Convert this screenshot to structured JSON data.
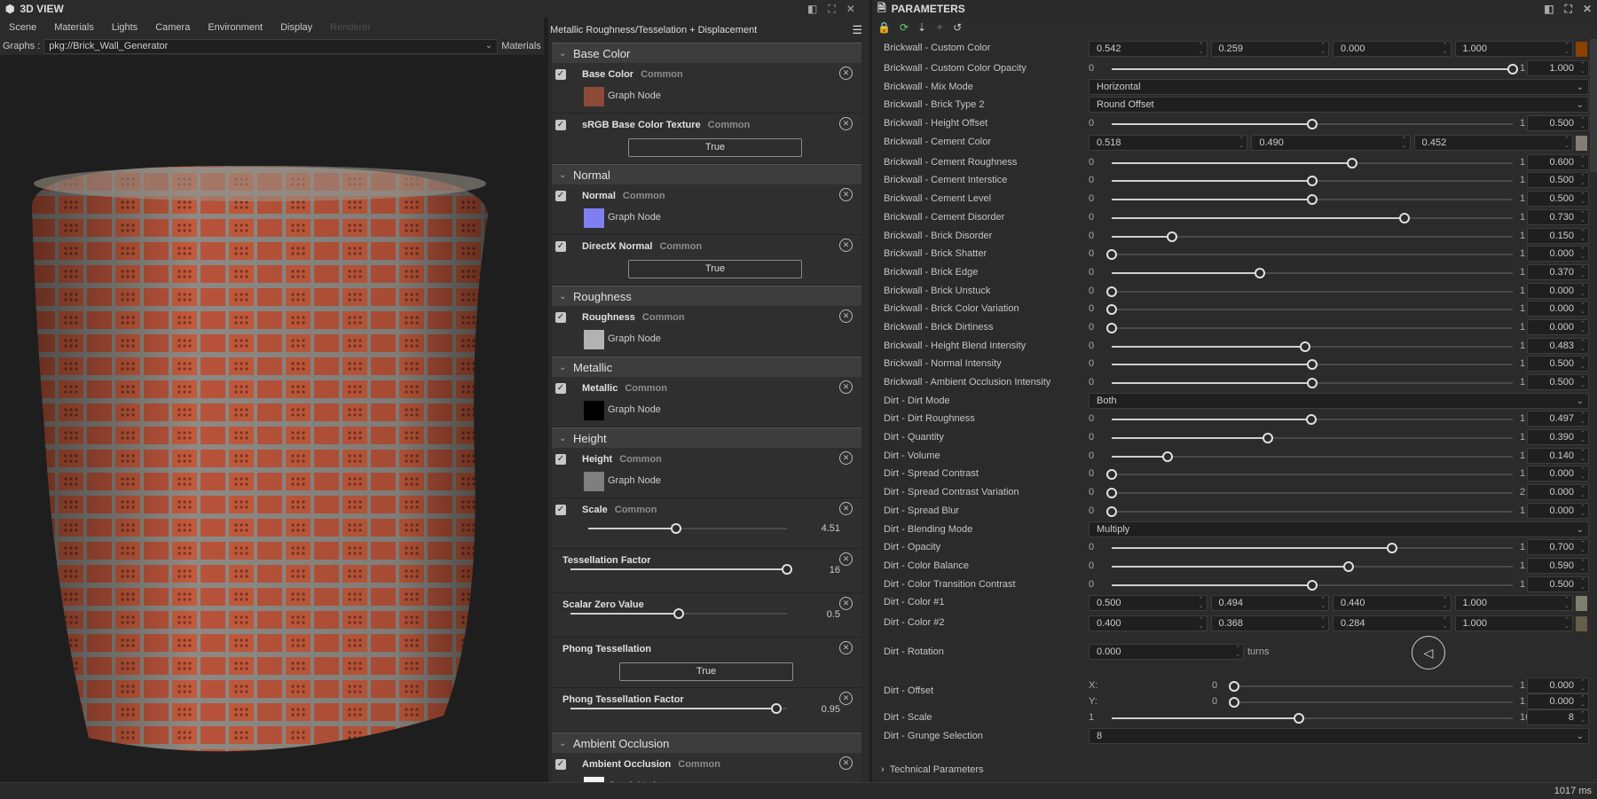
{
  "view3d": {
    "title": "3D VIEW",
    "menu": [
      "Scene",
      "Materials",
      "Lights",
      "Camera",
      "Environment",
      "Display",
      "Renderer"
    ],
    "graphs_label": "Graphs :",
    "graph_value": "pkg://Brick_Wall_Generator",
    "materials_label": "Materials"
  },
  "middle": {
    "title": "Metallic Roughness/Tesselation + Displacement",
    "sections": [
      {
        "title": "Base Color",
        "items": [
          {
            "kind": "node",
            "check": true,
            "name": "Base Color",
            "tag": "Common",
            "swatch": "#8e4a38",
            "node": "Graph Node"
          },
          {
            "kind": "bool",
            "check": true,
            "name": "sRGB Base Color Texture",
            "tag": "Common",
            "value": "True"
          }
        ]
      },
      {
        "title": "Normal",
        "items": [
          {
            "kind": "node",
            "check": true,
            "name": "Normal",
            "tag": "Common",
            "swatch": "#7f7ff2",
            "node": "Graph Node"
          },
          {
            "kind": "bool",
            "check": true,
            "name": "DirectX Normal",
            "tag": "Common",
            "value": "True"
          }
        ]
      },
      {
        "title": "Roughness",
        "items": [
          {
            "kind": "node",
            "check": true,
            "name": "Roughness",
            "tag": "Common",
            "swatch": "#b2b2b2",
            "node": "Graph Node"
          }
        ]
      },
      {
        "title": "Metallic",
        "items": [
          {
            "kind": "node",
            "check": true,
            "name": "Metallic",
            "tag": "Common",
            "swatch": "#000000",
            "node": "Graph Node"
          }
        ]
      },
      {
        "title": "Height",
        "items": [
          {
            "kind": "node",
            "check": true,
            "name": "Height",
            "tag": "Common",
            "swatch": "#7f7f7f",
            "node": "Graph Node"
          },
          {
            "kind": "slider",
            "check": true,
            "name": "Scale",
            "tag": "Common",
            "value": "4.51",
            "fraction": 0.44
          },
          {
            "kind": "slider",
            "check": false,
            "name": "Tessellation Factor",
            "value": "16",
            "fraction": 1.0
          },
          {
            "kind": "slider",
            "check": false,
            "name": "Scalar Zero Value",
            "value": "0.5",
            "fraction": 0.5
          },
          {
            "kind": "bool",
            "check": false,
            "name": "Phong Tessellation",
            "value": "True"
          },
          {
            "kind": "slider",
            "check": false,
            "name": "Phong Tessellation Factor",
            "value": "0.95",
            "fraction": 0.95
          }
        ]
      },
      {
        "title": "Ambient Occlusion",
        "items": [
          {
            "kind": "node",
            "check": true,
            "name": "Ambient Occlusion",
            "tag": "Common",
            "swatch": "#f2f2f2",
            "node": "Graph Node"
          }
        ]
      }
    ]
  },
  "params": {
    "title": "PARAMETERS",
    "rows": [
      {
        "type": "color",
        "label": "Brickwall - Custom Color",
        "values": [
          "0.542",
          "0.259",
          "0.000",
          "1.000"
        ],
        "swatch": "#8a4200"
      },
      {
        "type": "slider",
        "label": "Brickwall - Custom Color Opacity",
        "min": "0",
        "max": "1",
        "value": "1.000",
        "fraction": 1.0
      },
      {
        "type": "select",
        "label": "Brickwall - Mix Mode",
        "value": "Horizontal"
      },
      {
        "type": "select",
        "label": "Brickwall - Brick Type 2",
        "value": "Round Offset"
      },
      {
        "type": "slider",
        "label": "Brickwall - Height Offset",
        "min": "0",
        "max": "1",
        "value": "0.500",
        "fraction": 0.5
      },
      {
        "type": "color",
        "label": "Brickwall - Cement Color",
        "values": [
          "0.518",
          "0.490",
          "0.452"
        ],
        "swatch": "#847d73"
      },
      {
        "type": "slider",
        "label": "Brickwall - Cement Roughness",
        "min": "0",
        "max": "1",
        "value": "0.600",
        "fraction": 0.6
      },
      {
        "type": "slider",
        "label": "Brickwall - Cement Interstice",
        "min": "0",
        "max": "1",
        "value": "0.500",
        "fraction": 0.5
      },
      {
        "type": "slider",
        "label": "Brickwall - Cement Level",
        "min": "0",
        "max": "1",
        "value": "0.500",
        "fraction": 0.5
      },
      {
        "type": "slider",
        "label": "Brickwall - Cement Disorder",
        "min": "0",
        "max": "1",
        "value": "0.730",
        "fraction": 0.73
      },
      {
        "type": "slider",
        "label": "Brickwall - Brick Disorder",
        "min": "0",
        "max": "1",
        "value": "0.150",
        "fraction": 0.15
      },
      {
        "type": "slider",
        "label": "Brickwall - Brick Shatter",
        "min": "0",
        "max": "1",
        "value": "0.000",
        "fraction": 0
      },
      {
        "type": "slider",
        "label": "Brickwall - Brick Edge",
        "min": "0",
        "max": "1",
        "value": "0.370",
        "fraction": 0.37
      },
      {
        "type": "slider",
        "label": "Brickwall - Brick Unstuck",
        "min": "0",
        "max": "1",
        "value": "0.000",
        "fraction": 0
      },
      {
        "type": "slider",
        "label": "Brickwall - Brick Color Variation",
        "min": "0",
        "max": "1",
        "value": "0.000",
        "fraction": 0
      },
      {
        "type": "slider",
        "label": "Brickwall - Brick Dirtiness",
        "min": "0",
        "max": "1",
        "value": "0.000",
        "fraction": 0
      },
      {
        "type": "slider",
        "label": "Brickwall - Height Blend Intensity",
        "min": "0",
        "max": "1",
        "value": "0.483",
        "fraction": 0.483
      },
      {
        "type": "slider",
        "label": "Brickwall - Normal Intensity",
        "min": "0",
        "max": "1",
        "value": "0.500",
        "fraction": 0.5
      },
      {
        "type": "slider",
        "label": "Brickwall - Ambient Occlusion Intensity",
        "min": "0",
        "max": "1",
        "value": "0.500",
        "fraction": 0.5
      },
      {
        "type": "select",
        "label": "Dirt - Dirt Mode",
        "value": "Both"
      },
      {
        "type": "slider",
        "label": "Dirt - Dirt Roughness",
        "min": "0",
        "max": "1",
        "value": "0.497",
        "fraction": 0.497
      },
      {
        "type": "slider",
        "label": "Dirt - Quantity",
        "min": "0",
        "max": "1",
        "value": "0.390",
        "fraction": 0.39
      },
      {
        "type": "slider",
        "label": "Dirt - Volume",
        "min": "0",
        "max": "1",
        "value": "0.140",
        "fraction": 0.14
      },
      {
        "type": "slider",
        "label": "Dirt - Spread Contrast",
        "min": "0",
        "max": "1",
        "value": "0.000",
        "fraction": 0
      },
      {
        "type": "slider",
        "label": "Dirt - Spread Contrast Variation",
        "min": "0",
        "max": "2",
        "value": "0.000",
        "fraction": 0
      },
      {
        "type": "slider",
        "label": "Dirt - Spread Blur",
        "min": "0",
        "max": "1",
        "value": "0.000",
        "fraction": 0
      },
      {
        "type": "select",
        "label": "Dirt - Blending Mode",
        "value": "Multiply"
      },
      {
        "type": "slider",
        "label": "Dirt - Opacity",
        "min": "0",
        "max": "1",
        "value": "0.700",
        "fraction": 0.7
      },
      {
        "type": "slider",
        "label": "Dirt - Color Balance",
        "min": "0",
        "max": "1",
        "value": "0.590",
        "fraction": 0.59
      },
      {
        "type": "slider",
        "label": "Dirt - Color Transition Contrast",
        "min": "0",
        "max": "1",
        "value": "0.500",
        "fraction": 0.5
      },
      {
        "type": "color",
        "label": "Dirt - Color #1",
        "values": [
          "0.500",
          "0.494",
          "0.440",
          "1.000"
        ],
        "swatch": "#807e70"
      },
      {
        "type": "color",
        "label": "Dirt - Color #2",
        "values": [
          "0.400",
          "0.368",
          "0.284",
          "1.000"
        ],
        "swatch": "#665e48"
      },
      {
        "type": "rot",
        "label": "Dirt - Rotation",
        "value": "0.000",
        "unit": "turns"
      },
      {
        "type": "off",
        "label": "Dirt - Offset",
        "x_label": "X:",
        "y_label": "Y:",
        "min": "0",
        "max": "1",
        "x": "0.000",
        "y": "0.000",
        "fx": 0,
        "fy": 0
      },
      {
        "type": "slider",
        "label": "Dirt - Scale",
        "min": "1",
        "max": "16",
        "value": "8",
        "fraction": 0.467
      },
      {
        "type": "select",
        "label": "Dirt - Grunge Selection",
        "value": "8"
      }
    ],
    "technical": "Technical Parameters"
  },
  "status": {
    "time": "1017 ms"
  }
}
